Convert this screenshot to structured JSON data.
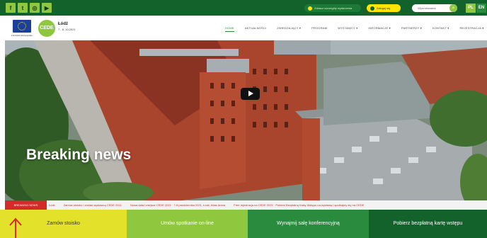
{
  "social": {
    "icons": [
      {
        "name": "facebook-icon",
        "glyph": "f"
      },
      {
        "name": "twitter-icon",
        "glyph": "t"
      },
      {
        "name": "instagram-icon",
        "glyph": "◎"
      },
      {
        "name": "youtube-icon",
        "glyph": "▶"
      }
    ]
  },
  "topbar": {
    "notify_label": "Zobacz szczegóły wydarzenia",
    "login_label": "Zaloguj się",
    "search_placeholder": "Wyszukiwarka",
    "search_icon": "⌕",
    "lang_pl": "PL",
    "lang_en": "EN"
  },
  "header": {
    "eu_caption": "Fundusze Europejskie",
    "logo_text": "CEDE",
    "logo_city": "Łódź",
    "logo_date": "7 - 8 .10.2021",
    "nav": [
      {
        "name": "nav-home",
        "label": "HOME",
        "active": true
      },
      {
        "name": "nav-aktualnosci",
        "label": "AKTUALNOŚCI"
      },
      {
        "name": "nav-zwiedzajacy",
        "label": "ZWIEDZAJĄCY ▾"
      },
      {
        "name": "nav-program",
        "label": "PROGRAM"
      },
      {
        "name": "nav-wystawcy",
        "label": "WYSTAWCY ▾"
      },
      {
        "name": "nav-informacje",
        "label": "INFORMACJE ▾"
      },
      {
        "name": "nav-partnerzy",
        "label": "PARTNERZY ▾"
      },
      {
        "name": "nav-kontakt",
        "label": "KONTAKT ▾"
      },
      {
        "name": "nav-rejestracja",
        "label": "REJESTRACJA ▾"
      }
    ]
  },
  "hero": {
    "headline": "Breaking news"
  },
  "ticker": {
    "label": "BREAKING NEWS",
    "items": [
      "Łódź",
      "Zamów stoisko i zostań wystawcą CEDE 2021",
      "Nowa data i miejsce CEDE 2021 · 7-8 października 2021, Łódź, Atlas Arena",
      "Free rejestracja na CEDE 2021 · Pobierz Bezpłatną Kartę Wstępu na wystawę i spotkajmy się na CEDE"
    ]
  },
  "actions": [
    {
      "name": "order-stand-button",
      "label": "Zamów stoisko"
    },
    {
      "name": "online-meeting-button",
      "label": "Umów spotkanie on-line"
    },
    {
      "name": "rent-room-button",
      "label": "Wynajmij salę konferencyjną"
    },
    {
      "name": "free-ticket-button",
      "label": "Pobierz bezpłatną kartę wstępu"
    }
  ],
  "colors": {
    "dark_green": "#13612b",
    "green": "#2a8a3e",
    "lime": "#8fc73e",
    "yellow": "#e3e12a",
    "red": "#d52a2a"
  }
}
